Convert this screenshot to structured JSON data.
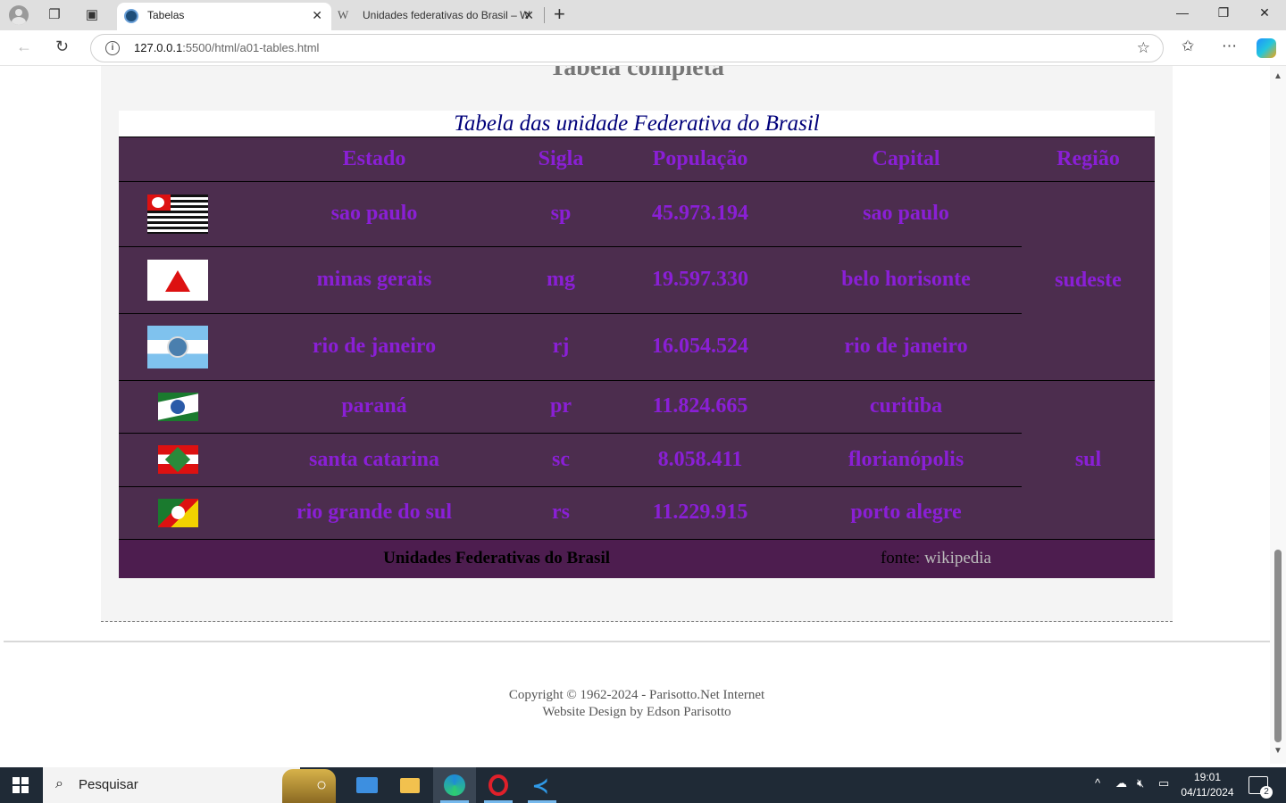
{
  "browser": {
    "tabs": [
      {
        "title": "Tabelas",
        "active": true
      },
      {
        "title": "Unidades federativas do Brasil – W",
        "active": false
      }
    ],
    "url": {
      "host": "127.0.0.1",
      "path": ":5500/html/a01-tables.html"
    },
    "window_controls": {
      "minimize": "—",
      "restore": "❐",
      "close": "✕"
    }
  },
  "page": {
    "section_title": "Tabela completa",
    "table": {
      "caption": "Tabela das unidade Federativa do Brasil",
      "headers": [
        "",
        "Estado",
        "Sigla",
        "População",
        "Capital",
        "Região"
      ],
      "rows": [
        {
          "flag": "sao-paulo-flag-icon",
          "estado": "sao paulo",
          "sigla": "sp",
          "populacao": "45.973.194",
          "capital": "sao paulo"
        },
        {
          "flag": "minas-gerais-flag-icon",
          "estado": "minas gerais",
          "sigla": "mg",
          "populacao": "19.597.330",
          "capital": "belo horisonte"
        },
        {
          "flag": "rio-de-janeiro-flag-icon",
          "estado": "rio de janeiro",
          "sigla": "rj",
          "populacao": "16.054.524",
          "capital": "rio de janeiro"
        },
        {
          "flag": "parana-flag-icon",
          "estado": "paraná",
          "sigla": "pr",
          "populacao": "11.824.665",
          "capital": "curitiba"
        },
        {
          "flag": "santa-catarina-flag-icon",
          "estado": "santa catarina",
          "sigla": "sc",
          "populacao": "8.058.411",
          "capital": "florianópolis"
        },
        {
          "flag": "rio-grande-do-sul-flag-icon",
          "estado": "rio grande do sul",
          "sigla": "rs",
          "populacao": "11.229.915",
          "capital": "porto alegre"
        }
      ],
      "regions": [
        "sudeste",
        "sul"
      ],
      "footer": {
        "title": "Unidades Federativas do Brasil",
        "source_label": "fonte:",
        "source_link": "wikipedia"
      }
    },
    "copyright": {
      "line1": "Copyright © 1962-2024 - Parisotto.Net Internet",
      "line2": "Website Design by Edson Parisotto"
    }
  },
  "taskbar": {
    "search_placeholder": "Pesquisar",
    "time": "19:01",
    "date": "04/11/2024",
    "notification_count": "2"
  },
  "colors": {
    "table_bg": "#4c2d4e",
    "table_text": "#8a1fd6",
    "caption_text": "#00007a",
    "footer_bg": "#4d1d4f"
  }
}
